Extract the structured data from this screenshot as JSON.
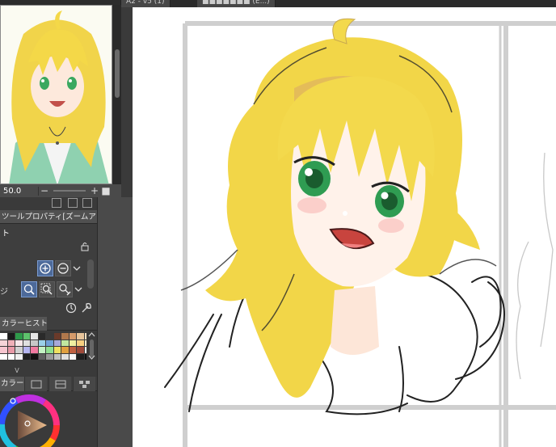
{
  "navigator": {
    "zoom": "50.0",
    "minus_label": "−",
    "plus_label": "+",
    "fit_label": "■"
  },
  "document_tabs": [
    {
      "label": "A2 - v5 (1)"
    },
    {
      "label": "■■■■■■■ (E...)"
    }
  ],
  "tool_property": {
    "tab_label": "ツールプロパティ[ズームアウト]",
    "tool_name": "ト",
    "row1_label": "",
    "row2_label": "ジ"
  },
  "color_history": {
    "tab_label": "カラーヒストリー",
    "collapse_label": "V"
  },
  "color_wheel": {
    "tab_label": "カラー"
  },
  "colors": {
    "accent_blue": "#4d6a9a",
    "hair_yellow": "#f2d648",
    "eye_green": "#3fae5a"
  },
  "swatches": [
    "#ffffff",
    "#1b1b1b",
    "#2e9a4a",
    "#5ec36c",
    "#e6e6e6",
    "#2a2a2a",
    "#3a3a3a",
    "#6a3a2a",
    "#b0784c",
    "#d59a6a",
    "#e7c49a",
    "#f5e0c0",
    "#f6d4d8",
    "#f0b0b8",
    "#f7e7e9",
    "#e0e0e0",
    "#c8c8c8",
    "#9ad0e8",
    "#70a0d8",
    "#a8a8d8",
    "#c0e8a0",
    "#f0f0a0",
    "#f8d080",
    "#fff4d0",
    "#f7c6d0",
    "#e99aa8",
    "#d1d1d1",
    "#b5b5f0",
    "#f07aa0",
    "#c4f2c4",
    "#90e090",
    "#f0e060",
    "#e0a040",
    "#c06040",
    "#a04a3a",
    "#ffffff",
    "#ffffff",
    "#ffffff",
    "#f0f0f0",
    "#202020",
    "#101010",
    "#606060",
    "#999999",
    "#c0c0c0",
    "#e0e0e0",
    "#f8f8f8",
    "#202020",
    "#101010"
  ]
}
